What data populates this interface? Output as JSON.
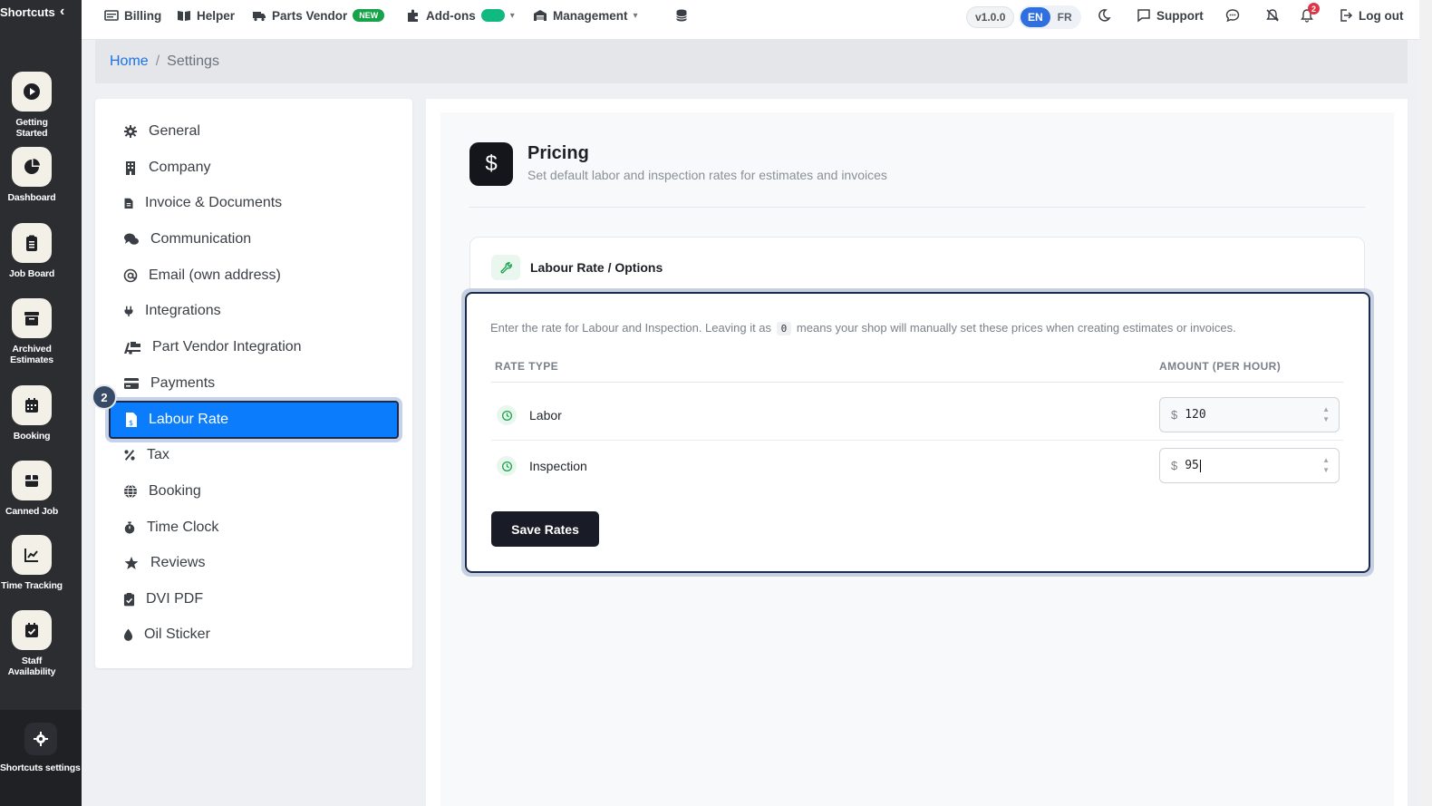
{
  "shortcuts": {
    "title": "Shortcuts",
    "items": [
      {
        "label": "Getting Started",
        "icon": "play-icon"
      },
      {
        "label": "Dashboard",
        "icon": "pie-chart-icon"
      },
      {
        "label": "Job Board",
        "icon": "clipboard-icon"
      },
      {
        "label": "Archived Estimates",
        "icon": "archive-icon"
      },
      {
        "label": "Booking",
        "icon": "calendar-icon"
      },
      {
        "label": "Canned Job",
        "icon": "box-icon"
      },
      {
        "label": "Time Tracking",
        "icon": "chart-line-icon"
      },
      {
        "label": "Staff Availability",
        "icon": "calendar-check-icon"
      }
    ],
    "settings_label": "Shortcuts settings"
  },
  "topbar": {
    "billing": "Billing",
    "helper": "Helper",
    "parts_vendor": "Parts Vendor",
    "parts_vendor_badge": "NEW",
    "addons": "Add-ons",
    "management": "Management",
    "version": "v1.0.0",
    "lang_en": "EN",
    "lang_fr": "FR",
    "support": "Support",
    "notification_count": "2",
    "logout": "Log out"
  },
  "breadcrumb": {
    "home": "Home",
    "separator": "/",
    "current": "Settings"
  },
  "settings_nav": {
    "items": [
      {
        "label": "General",
        "icon": "gear-icon"
      },
      {
        "label": "Company",
        "icon": "building-icon"
      },
      {
        "label": "Invoice & Documents",
        "icon": "file-invoice-icon"
      },
      {
        "label": "Communication",
        "icon": "comments-icon"
      },
      {
        "label": "Email (own address)",
        "icon": "at-icon"
      },
      {
        "label": "Integrations",
        "icon": "plug-icon"
      },
      {
        "label": "Part Vendor Integration",
        "icon": "truck-loading-icon"
      },
      {
        "label": "Payments",
        "icon": "credit-card-icon"
      },
      {
        "label": "Labour Rate",
        "icon": "file-dollar-icon",
        "active": true
      },
      {
        "label": "Tax",
        "icon": "percent-icon"
      },
      {
        "label": "Booking",
        "icon": "globe-icon"
      },
      {
        "label": "Time Clock",
        "icon": "stopwatch-icon"
      },
      {
        "label": "Reviews",
        "icon": "star-icon"
      },
      {
        "label": "DVI PDF",
        "icon": "clipboard-check-icon"
      },
      {
        "label": "Oil Sticker",
        "icon": "droplet-icon"
      }
    ],
    "step_badge": "2"
  },
  "pricing": {
    "icon_glyph": "$",
    "title": "Pricing",
    "subtitle": "Set default labor and inspection rates for estimates and invoices"
  },
  "labour_card": {
    "title": "Labour Rate / Options",
    "help_before": "Enter the rate for Labour and Inspection. Leaving it as",
    "help_code": "0",
    "help_after": "means your shop will manually set these prices when creating estimates or invoices.",
    "col_rate_type": "RATE TYPE",
    "col_amount": "AMOUNT (PER HOUR)",
    "currency_symbol": "$",
    "rows": [
      {
        "label": "Labor",
        "value": "120"
      },
      {
        "label": "Inspection",
        "value": "95"
      }
    ],
    "save_label": "Save Rates"
  },
  "colors": {
    "accent": "#0b7dfc",
    "dark_button": "#191b26",
    "success": "#16a34a"
  }
}
